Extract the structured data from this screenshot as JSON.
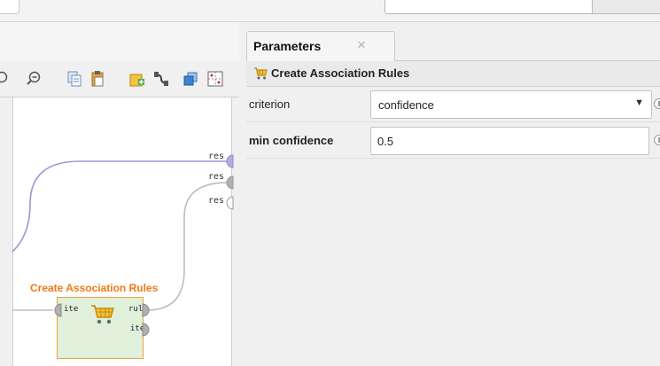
{
  "parameters_panel": {
    "tab_label": "Parameters",
    "tab_close_glyph": "×",
    "header_icon": "cart-icon",
    "operator_title": "Create Association Rules",
    "params": [
      {
        "label": "criterion",
        "type": "select",
        "value": "confidence",
        "dropdown_glyph": "▼"
      },
      {
        "label": "min confidence",
        "type": "number",
        "value": "0.5"
      }
    ]
  },
  "process_canvas": {
    "toolbar_icons": [
      "zoom-in-icon",
      "zoom-out-icon",
      "copy-icon",
      "paste-icon",
      "add-building-block-icon",
      "connect-icon",
      "layers-icon",
      "grid-icon"
    ],
    "result_ports": [
      "res",
      "res",
      "res"
    ],
    "operator": {
      "title": "Create Association Rules",
      "icon": "cart-icon",
      "input_ports": [
        "ite"
      ],
      "output_ports": [
        "rul",
        "ite"
      ]
    }
  },
  "colors": {
    "operator_title": "#f07a14",
    "operator_fill": "#e0f0da",
    "operator_border": "#f0a040",
    "connection_purple": "#9d95d8",
    "connection_gray": "#bdbdbd"
  }
}
